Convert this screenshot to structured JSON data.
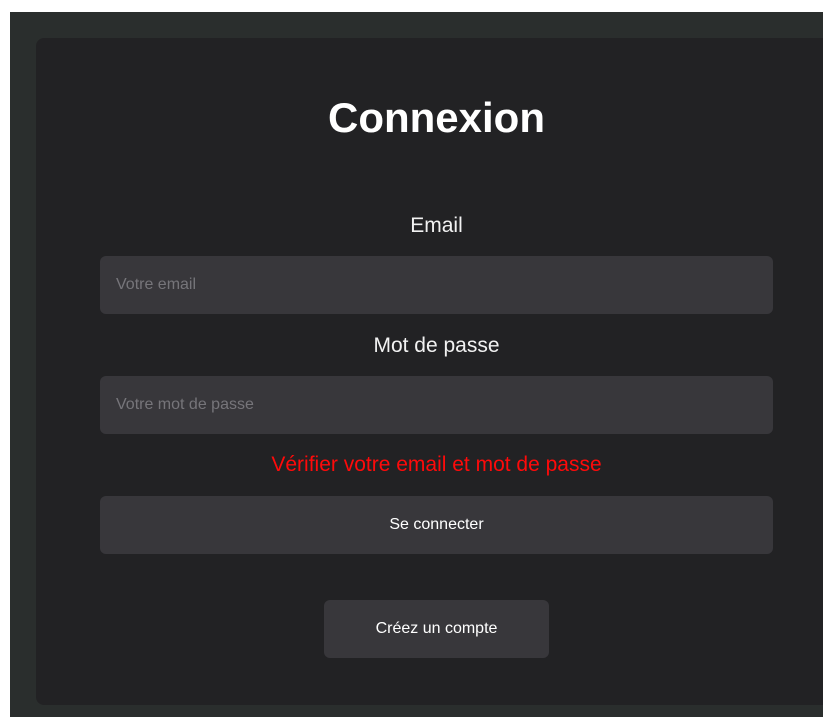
{
  "login": {
    "title": "Connexion",
    "email_label": "Email",
    "email_placeholder": "Votre email",
    "email_value": "",
    "password_label": "Mot de passe",
    "password_placeholder": "Votre mot de passe",
    "password_value": "",
    "error_message": "Vérifier votre email et mot de passe",
    "submit_label": "Se connecter",
    "register_label": "Créez un compte"
  },
  "colors": {
    "page_background": "#2a2e2d",
    "card_background": "#222224",
    "input_background": "#38373b",
    "error": "#ff0a0a",
    "text": "#ffffff"
  }
}
